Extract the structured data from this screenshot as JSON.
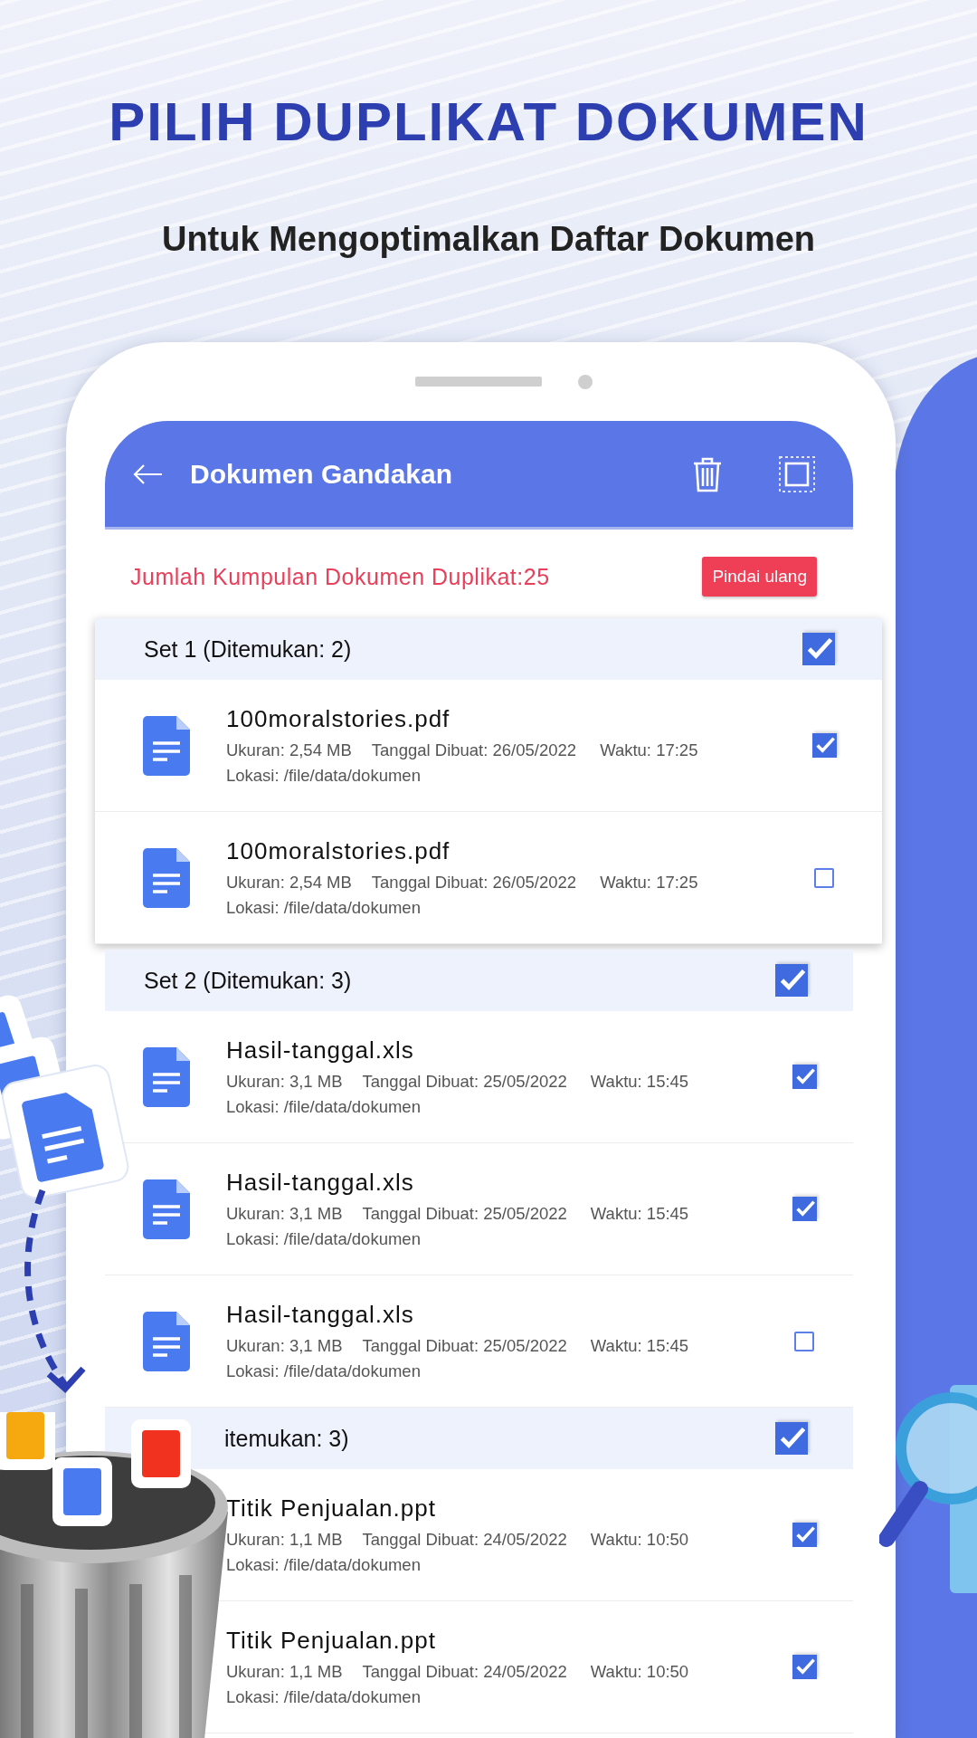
{
  "headline": "PILIH DUPLIKAT DOKUMEN",
  "subtitle": "Untuk Mengoptimalkan Daftar Dokumen",
  "app_bar": {
    "title": "Dokumen Gandakan"
  },
  "summary": {
    "text": "Jumlah Kumpulan Dokumen Duplikat:25",
    "button": "Pindai ulang"
  },
  "sets": [
    {
      "title": "Set 1 (Ditemukan: 2)",
      "checked": true,
      "highlighted": true,
      "partly_hidden": false,
      "items": [
        {
          "name": "100moralstories.pdf",
          "size": "Ukuran: 2,54 MB",
          "date": "Tanggal Dibuat: 26/05/2022",
          "time": "Waktu: 17:25",
          "location": "Lokasi: /file/data/dokumen",
          "checked": true
        },
        {
          "name": "100moralstories.pdf",
          "size": "Ukuran: 2,54 MB",
          "date": "Tanggal Dibuat: 26/05/2022",
          "time": "Waktu: 17:25",
          "location": "Lokasi: /file/data/dokumen",
          "checked": false
        }
      ]
    },
    {
      "title": "Set 2 (Ditemukan: 3)",
      "checked": true,
      "highlighted": false,
      "partly_hidden": false,
      "items": [
        {
          "name": "Hasil-tanggal.xls",
          "size": "Ukuran: 3,1 MB",
          "date": "Tanggal Dibuat: 25/05/2022",
          "time": "Waktu: 15:45",
          "location": "Lokasi: /file/data/dokumen",
          "checked": true
        },
        {
          "name": "Hasil-tanggal.xls",
          "size": "Ukuran: 3,1 MB",
          "date": "Tanggal Dibuat: 25/05/2022",
          "time": "Waktu: 15:45",
          "location": "Lokasi: /file/data/dokumen",
          "checked": true
        },
        {
          "name": "Hasil-tanggal.xls",
          "size": "Ukuran: 3,1 MB",
          "date": "Tanggal Dibuat: 25/05/2022",
          "time": "Waktu: 15:45",
          "location": "Lokasi: /file/data/dokumen",
          "checked": false
        }
      ]
    },
    {
      "title": "itemukan: 3)",
      "checked": true,
      "highlighted": false,
      "partly_hidden": true,
      "items": [
        {
          "name": "Titik Penjualan.ppt",
          "size": "Ukuran: 1,1 MB",
          "date": "Tanggal Dibuat: 24/05/2022",
          "time": "Waktu: 10:50",
          "location": "Lokasi: /file/data/dokumen",
          "checked": true
        },
        {
          "name": "Titik Penjualan.ppt",
          "size": "Ukuran: 1,1 MB",
          "date": "Tanggal Dibuat: 24/05/2022",
          "time": "Waktu: 10:50",
          "location": "Lokasi: /file/data/dokumen",
          "checked": true
        }
      ]
    }
  ]
}
